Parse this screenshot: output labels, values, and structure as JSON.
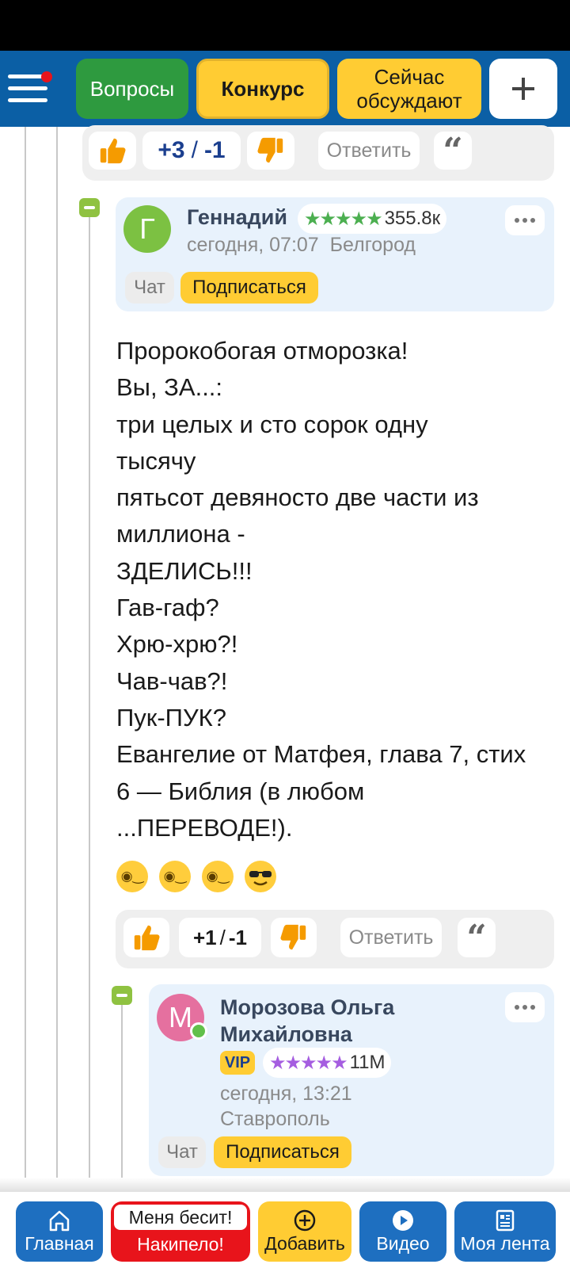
{
  "topnav": {
    "questions_label": "Вопросы",
    "contest_label": "Конкурс",
    "discussed_line1": "Сейчас",
    "discussed_line2": "обсуждают",
    "plus_icon": "plus-icon"
  },
  "parent_votes": {
    "up": "+3",
    "separator": "/",
    "down": "-1",
    "reply_label": "Ответить"
  },
  "comment": {
    "author": "Геннадий",
    "avatar_letter": "Г",
    "avatar_color": "#7cc142",
    "stars": "★★★★★",
    "star_color": "#4caf50",
    "rating": "355.8к",
    "date": "сегодня, 07:07",
    "city": "Белгород",
    "chat_label": "Чат",
    "subscribe_label": "Подписаться",
    "body_lines": [
      "Пророкобогая отморозка!",
      "Вы, ЗА...:",
      "три целых и сто сорок одну",
      "тысячу",
      "пятьсот девяносто две части из",
      "миллиона -",
      "ЗДЕЛИСЬ!!!",
      "Гав-гаф?",
      "Хрю-хрю?!",
      "Чав-чав?!",
      "Пук-ПУК?",
      "Евангелие от Матфея, глава 7, стих",
      "6 — Библия (в любом",
      "...ПЕРЕВОДЕ!)."
    ],
    "emojis": [
      "face-with-monocle-icon",
      "face-with-monocle-icon",
      "face-with-monocle-icon",
      "smiling-face-with-sunglasses-icon"
    ],
    "votes": {
      "up": "+1",
      "separator": "/",
      "down": "-1",
      "reply_label": "Ответить"
    }
  },
  "reply_comment": {
    "author_line1": "Морозова Ольга",
    "author_line2": "Михайловна",
    "avatar_letter": "М",
    "avatar_color": "#e5709f",
    "online": true,
    "vip_label": "VIP",
    "stars": "★★★★★",
    "star_color": "#a55de0",
    "rating": "11М",
    "date": "сегодня, 13:21",
    "city": "Ставрополь",
    "chat_label": "Чат",
    "subscribe_label": "Подписаться"
  },
  "bottomnav": {
    "home_label": "Главная",
    "rant_top_label": "Меня бесит!",
    "rant_bottom_label": "Накипело!",
    "add_label": "Добавить",
    "video_label": "Видео",
    "feed_label": "Моя лента"
  },
  "colors": {
    "nav_blue": "#0b5fa5",
    "accent_yellow": "#ffcc33",
    "green": "#2e9a3f",
    "score_blue": "#1b3f8f",
    "like_orange": "#f59b00"
  }
}
